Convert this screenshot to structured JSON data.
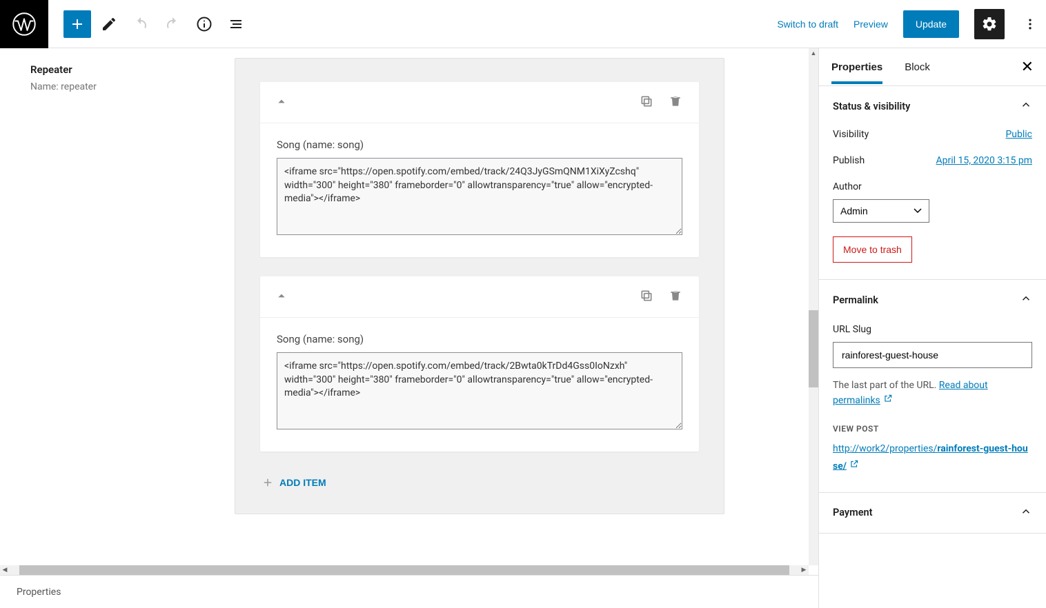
{
  "toolbar": {
    "switch_to_draft": "Switch to draft",
    "preview": "Preview",
    "update": "Update"
  },
  "repeater": {
    "title": "Repeater",
    "name_label": "Name: repeater",
    "add_item": "ADD ITEM",
    "items": [
      {
        "label": "Song (name: song)",
        "value": "<iframe src=\"https://open.spotify.com/embed/track/24Q3JyGSmQNM1XiXyZcshq\" width=\"300\" height=\"380\" frameborder=\"0\" allowtransparency=\"true\" allow=\"encrypted-media\"></iframe>"
      },
      {
        "label": "Song (name: song)",
        "value": "<iframe src=\"https://open.spotify.com/embed/track/2Bwta0kTrDd4Gss0IoNzxh\" width=\"300\" height=\"380\" frameborder=\"0\" allowtransparency=\"true\" allow=\"encrypted-media\"></iframe>"
      }
    ]
  },
  "sidebar": {
    "tabs": {
      "properties": "Properties",
      "block": "Block"
    },
    "panels": {
      "status": {
        "title": "Status & visibility",
        "visibility_lbl": "Visibility",
        "visibility_val": "Public",
        "publish_lbl": "Publish",
        "publish_val": "April 15, 2020 3:15 pm",
        "author_lbl": "Author",
        "author_val": "Admin",
        "trash": "Move to trash"
      },
      "permalink": {
        "title": "Permalink",
        "slug_lbl": "URL Slug",
        "slug_val": "rainforest-guest-house",
        "help_prefix": "The last part of the URL. ",
        "help_link": "Read about permalinks",
        "view_post": "VIEW POST",
        "url_prefix": "http://work2/properties/",
        "url_bold": "rainforest-guest-house/"
      },
      "payment": {
        "title": "Payment"
      }
    }
  },
  "footer": {
    "breadcrumb": "Properties"
  }
}
